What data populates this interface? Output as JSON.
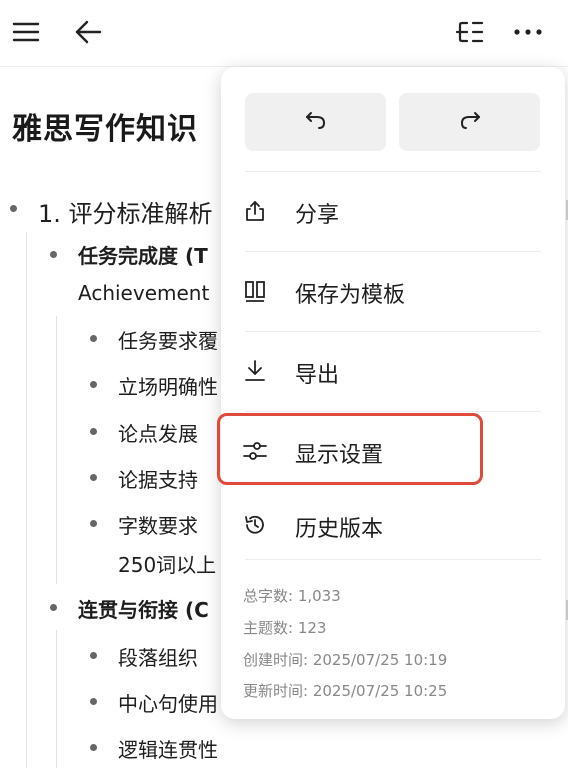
{
  "toolbar": {
    "menu_icon": "hamburger-icon",
    "back_icon": "arrow-left-icon",
    "outline_icon": "outline-toggle-icon",
    "more_icon": "more-horizontal-icon"
  },
  "document": {
    "title": "雅思写作知识",
    "lines": [
      {
        "text": "1. 评分标准解析"
      },
      {
        "text": "任务完成度 (T"
      },
      {
        "text": "Achievement"
      },
      {
        "text": "任务要求覆"
      },
      {
        "text": "立场明确性"
      },
      {
        "text": "论点发展"
      },
      {
        "text": "论据支持"
      },
      {
        "text": "字数要求"
      },
      {
        "text": "250词以上"
      },
      {
        "text": "连贯与衔接 (C"
      },
      {
        "text": "段落组织"
      },
      {
        "text": "中心句使用"
      },
      {
        "text": "逻辑连贯性"
      }
    ]
  },
  "popup": {
    "undo_icon": "undo-icon",
    "redo_icon": "redo-icon",
    "items": [
      {
        "label": "分享",
        "icon": "share-icon"
      },
      {
        "label": "保存为模板",
        "icon": "template-icon"
      },
      {
        "label": "导出",
        "icon": "download-icon"
      },
      {
        "label": "显示设置",
        "icon": "sliders-icon"
      },
      {
        "label": "历史版本",
        "icon": "history-icon"
      }
    ],
    "highlight_color": "#e04a3a",
    "stats": {
      "word_count": "总字数: 1,033",
      "topic_count": "主题数: 123",
      "created": "创建时间:  2025/07/25 10:19",
      "updated": "更新时间:  2025/07/25 10:25"
    }
  }
}
